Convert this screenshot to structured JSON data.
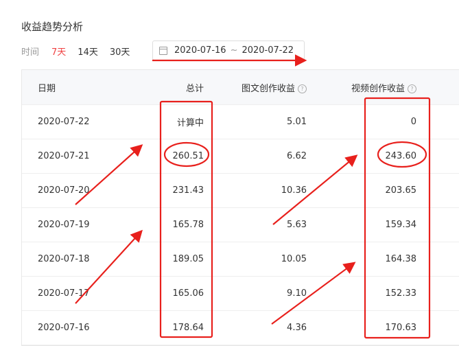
{
  "title": "收益趋势分析",
  "filters": {
    "label": "时间",
    "options": [
      {
        "label": "7天",
        "active": true
      },
      {
        "label": "14天",
        "active": false
      },
      {
        "label": "30天",
        "active": false
      }
    ],
    "date_start": "2020-07-16",
    "date_sep": "~",
    "date_end": "2020-07-22"
  },
  "table": {
    "headers": {
      "date": "日期",
      "total": "总计",
      "image_text": "图文创作收益",
      "video": "视频创作收益"
    },
    "help_glyph": "?",
    "rows": [
      {
        "date": "2020-07-22",
        "total": "计算中",
        "image_text": "5.01",
        "video": "0"
      },
      {
        "date": "2020-07-21",
        "total": "260.51",
        "image_text": "6.62",
        "video": "243.60"
      },
      {
        "date": "2020-07-20",
        "total": "231.43",
        "image_text": "10.36",
        "video": "203.65"
      },
      {
        "date": "2020-07-19",
        "total": "165.78",
        "image_text": "5.63",
        "video": "159.34"
      },
      {
        "date": "2020-07-18",
        "total": "189.05",
        "image_text": "10.05",
        "video": "164.38"
      },
      {
        "date": "2020-07-17",
        "total": "165.06",
        "image_text": "9.10",
        "video": "152.33"
      },
      {
        "date": "2020-07-16",
        "total": "178.64",
        "image_text": "4.36",
        "video": "170.63"
      }
    ]
  },
  "colors": {
    "accent": "#f04142",
    "annotation": "#e8201c"
  }
}
